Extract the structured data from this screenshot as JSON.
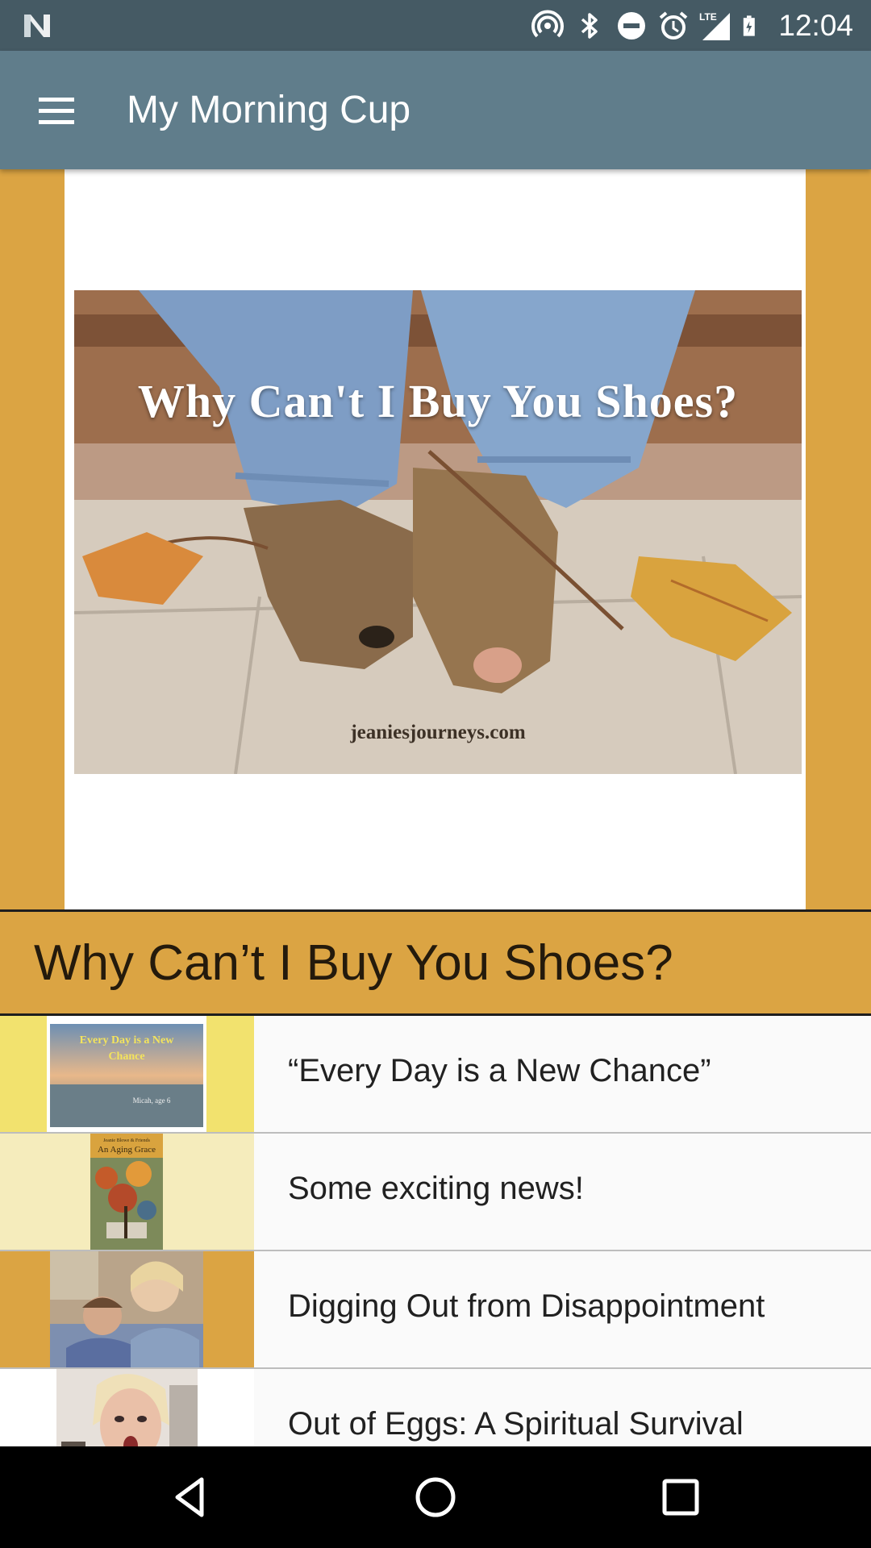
{
  "status_bar": {
    "time": "12:04",
    "network_label": "LTE",
    "icons": [
      "n-logo-icon",
      "hotspot-icon",
      "bluetooth-icon",
      "do-not-disturb-icon",
      "alarm-icon",
      "signal-icon",
      "battery-icon"
    ]
  },
  "app_bar": {
    "title": "My Morning Cup",
    "menu_icon": "hamburger-menu-icon",
    "color": "#607d8b"
  },
  "hero": {
    "background_color": "#dba443",
    "image_title": "Why Can't I Buy You Shoes?",
    "image_caption": "jeaniesjourneys.com"
  },
  "featured": {
    "title": "Why Can’t I Buy You Shoes?"
  },
  "posts": [
    {
      "title": "“Every Day is a New Chance”",
      "thumb_text": "Every Day is a New Chance",
      "thumb_caption": "Micah, age 6",
      "bg": "#f2e26e"
    },
    {
      "title": "Some exciting news!",
      "thumb_text": "An Aging Grace",
      "thumb_subtitle": "Jeanie Blowe & Friends",
      "bg": "#f5ecbc"
    },
    {
      "title": "Digging Out from Disappointment",
      "bg": "#dba443"
    },
    {
      "title": "Out of Eggs: A Spiritual Survival",
      "bg": "#ffffff"
    }
  ],
  "nav_bar": {
    "buttons": [
      "back-icon",
      "home-icon",
      "recents-icon"
    ]
  }
}
